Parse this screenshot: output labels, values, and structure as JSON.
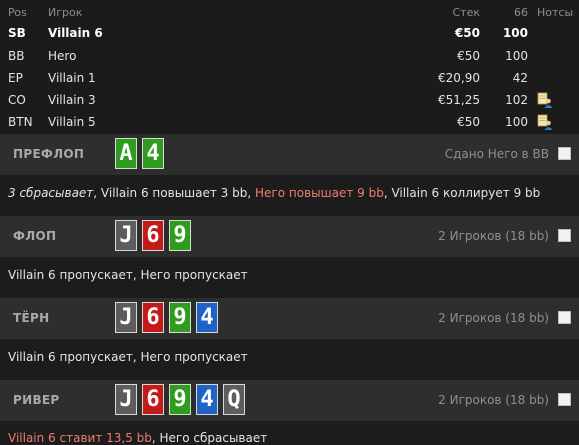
{
  "players_table": {
    "headers": {
      "pos": "Pos",
      "player": "Игрок",
      "stack": "Стек",
      "hands": "66",
      "notes": "Нотсы"
    },
    "rows": [
      {
        "pos": "SB",
        "name": "Villain 6",
        "stack": "€50",
        "hands": "100",
        "note_icon": ""
      },
      {
        "pos": "BB",
        "name": "Hero",
        "stack": "€50",
        "hands": "100",
        "note_icon": ""
      },
      {
        "pos": "EP",
        "name": "Villain 1",
        "stack": "€20,90",
        "hands": "42",
        "note_icon": ""
      },
      {
        "pos": "CO",
        "name": "Villain 3",
        "stack": "€51,25",
        "hands": "102",
        "note_icon": "note-person-icon"
      },
      {
        "pos": "BTN",
        "name": "Villain 5",
        "stack": "€50",
        "hands": "100",
        "note_icon": "note-person-icon"
      }
    ]
  },
  "streets": {
    "preflop": {
      "title": "ПРЕФЛОП",
      "info": "Сдано Него в BB",
      "cards": [
        {
          "rank": "A",
          "suit_color": "green"
        },
        {
          "rank": "4",
          "suit_color": "green"
        }
      ],
      "action": {
        "part1": "3 сбрасывает",
        "part2": ", Villain 6 повышает 3 bb, ",
        "part3": "Него повышает 9 bb",
        "part4": ", Villain 6 коллирует 9 bb"
      }
    },
    "flop": {
      "title": "ФЛОП",
      "info": "2 Игроков (18 bb)",
      "cards": [
        {
          "rank": "J",
          "suit_color": "gray"
        },
        {
          "rank": "6",
          "suit_color": "red"
        },
        {
          "rank": "9",
          "suit_color": "green"
        }
      ],
      "action": "Villain 6 пропускает, Него пропускает"
    },
    "turn": {
      "title": "ТЁРН",
      "info": "2 Игроков (18 bb)",
      "cards": [
        {
          "rank": "J",
          "suit_color": "gray"
        },
        {
          "rank": "6",
          "suit_color": "red"
        },
        {
          "rank": "9",
          "suit_color": "green"
        },
        {
          "rank": "4",
          "suit_color": "blue"
        }
      ],
      "action": "Villain 6 пропускает, Него пропускает"
    },
    "river": {
      "title": "РИВЕР",
      "info": "2 Игроков (18 bb)",
      "cards": [
        {
          "rank": "J",
          "suit_color": "gray"
        },
        {
          "rank": "6",
          "suit_color": "red"
        },
        {
          "rank": "9",
          "suit_color": "green"
        },
        {
          "rank": "4",
          "suit_color": "blue"
        },
        {
          "rank": "Q",
          "suit_color": "gray"
        }
      ],
      "action": {
        "part1": "Villain 6 ставит 13,5 bb",
        "part2": ", Него сбрасывает"
      }
    }
  },
  "colors": {
    "green": "#2e9c1d",
    "gray": "#5d5d5d",
    "red": "#c51a1a",
    "blue": "#1e63c7",
    "highlight": "#ef7d71"
  }
}
